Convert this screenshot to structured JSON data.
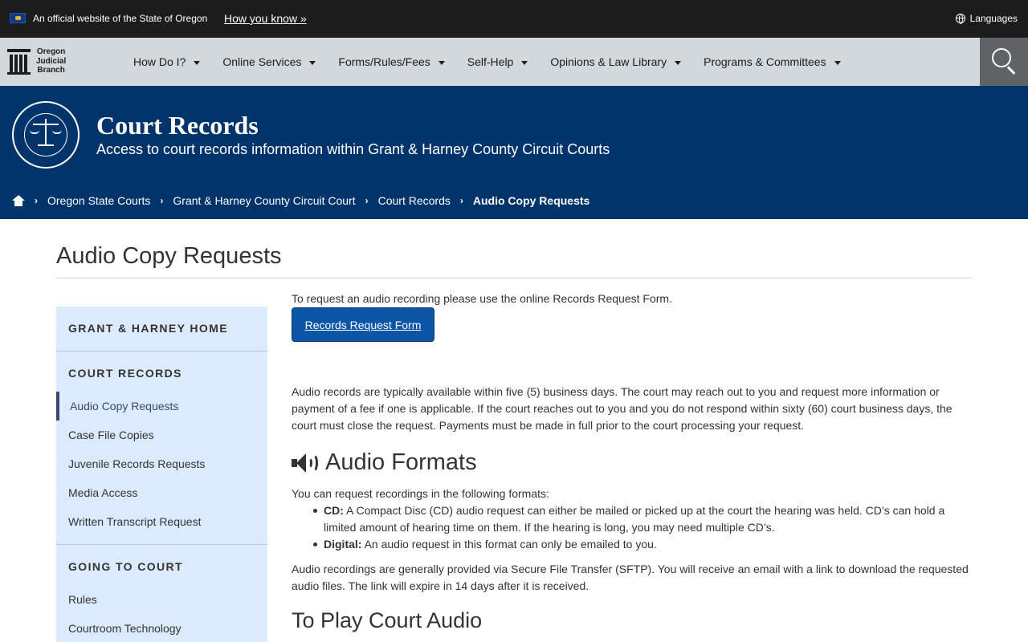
{
  "topbar": {
    "official_text": "An official website of the State of Oregon",
    "how_you_know": "How you know »",
    "languages": "Languages"
  },
  "logo": {
    "line1": "Oregon",
    "line2": "Judicial",
    "line3": "Branch"
  },
  "nav": {
    "items": [
      {
        "label": "How Do I?"
      },
      {
        "label": "Online Services"
      },
      {
        "label": "Forms/Rules/Fees"
      },
      {
        "label": "Self-Help"
      },
      {
        "label": "Opinions & Law Library"
      },
      {
        "label": "Programs & Committees"
      }
    ]
  },
  "hero": {
    "title": "Court Records",
    "subtitle": "Access to court records information within Grant & Harney County Circuit Courts"
  },
  "breadcrumbs": [
    {
      "label": "Oregon State Courts"
    },
    {
      "label": "Grant & Harney County Circuit Court"
    },
    {
      "label": "Court Records"
    },
    {
      "label": "Audio Copy Requests"
    }
  ],
  "page": {
    "title": "Audio Copy Requests"
  },
  "sidebar": {
    "home": "GRANT & HARNEY HOME",
    "section1": "COURT RECORDS",
    "section1_items": [
      {
        "label": "Audio Copy Requests"
      },
      {
        "label": "Case File Copies"
      },
      {
        "label": "Juvenile Records Requests"
      },
      {
        "label": "Media Access"
      },
      {
        "label": "Written Transcript Request"
      }
    ],
    "section2": "GOING TO COURT",
    "section2_items": [
      {
        "label": "Rules"
      },
      {
        "label": "Courtroom Technology"
      }
    ]
  },
  "content": {
    "intro": "To request an audio recording please use the online Records Request Form.",
    "button": "Records Request Form",
    "availability_lines": [
      "Audio records are typically available within five (5) business days. The court may reach out to you and request more information or",
      "payment of a fee if one is applicable. If the court reaches out to you and you do not respond within sixty (60) court business days, the",
      "court must close the request. Payments must be made in full prior to the court processing your request."
    ],
    "formats_heading": "Audio Formats",
    "formats_intro": "You can request recordings in the following formats:",
    "cd_label": "CD:",
    "cd_line1": " A Compact Disc (CD) audio request can either be mailed or picked up at the court the hearing was held. CD’s can hold a",
    "cd_line2": "limited amount of hearing time on them. If the hearing is long, you may need multiple CD’s.",
    "digital_label": "Digital:",
    "digital_text": " An audio request in this format can only be emailed to you.",
    "sftp_lines": [
      "Audio recordings are generally provided via Secure File Transfer (SFTP). You will receive an email with a link to download the requested",
      "audio files. The link will expire in 14 days after it is received."
    ],
    "play_heading": "To Play Court Audio"
  }
}
